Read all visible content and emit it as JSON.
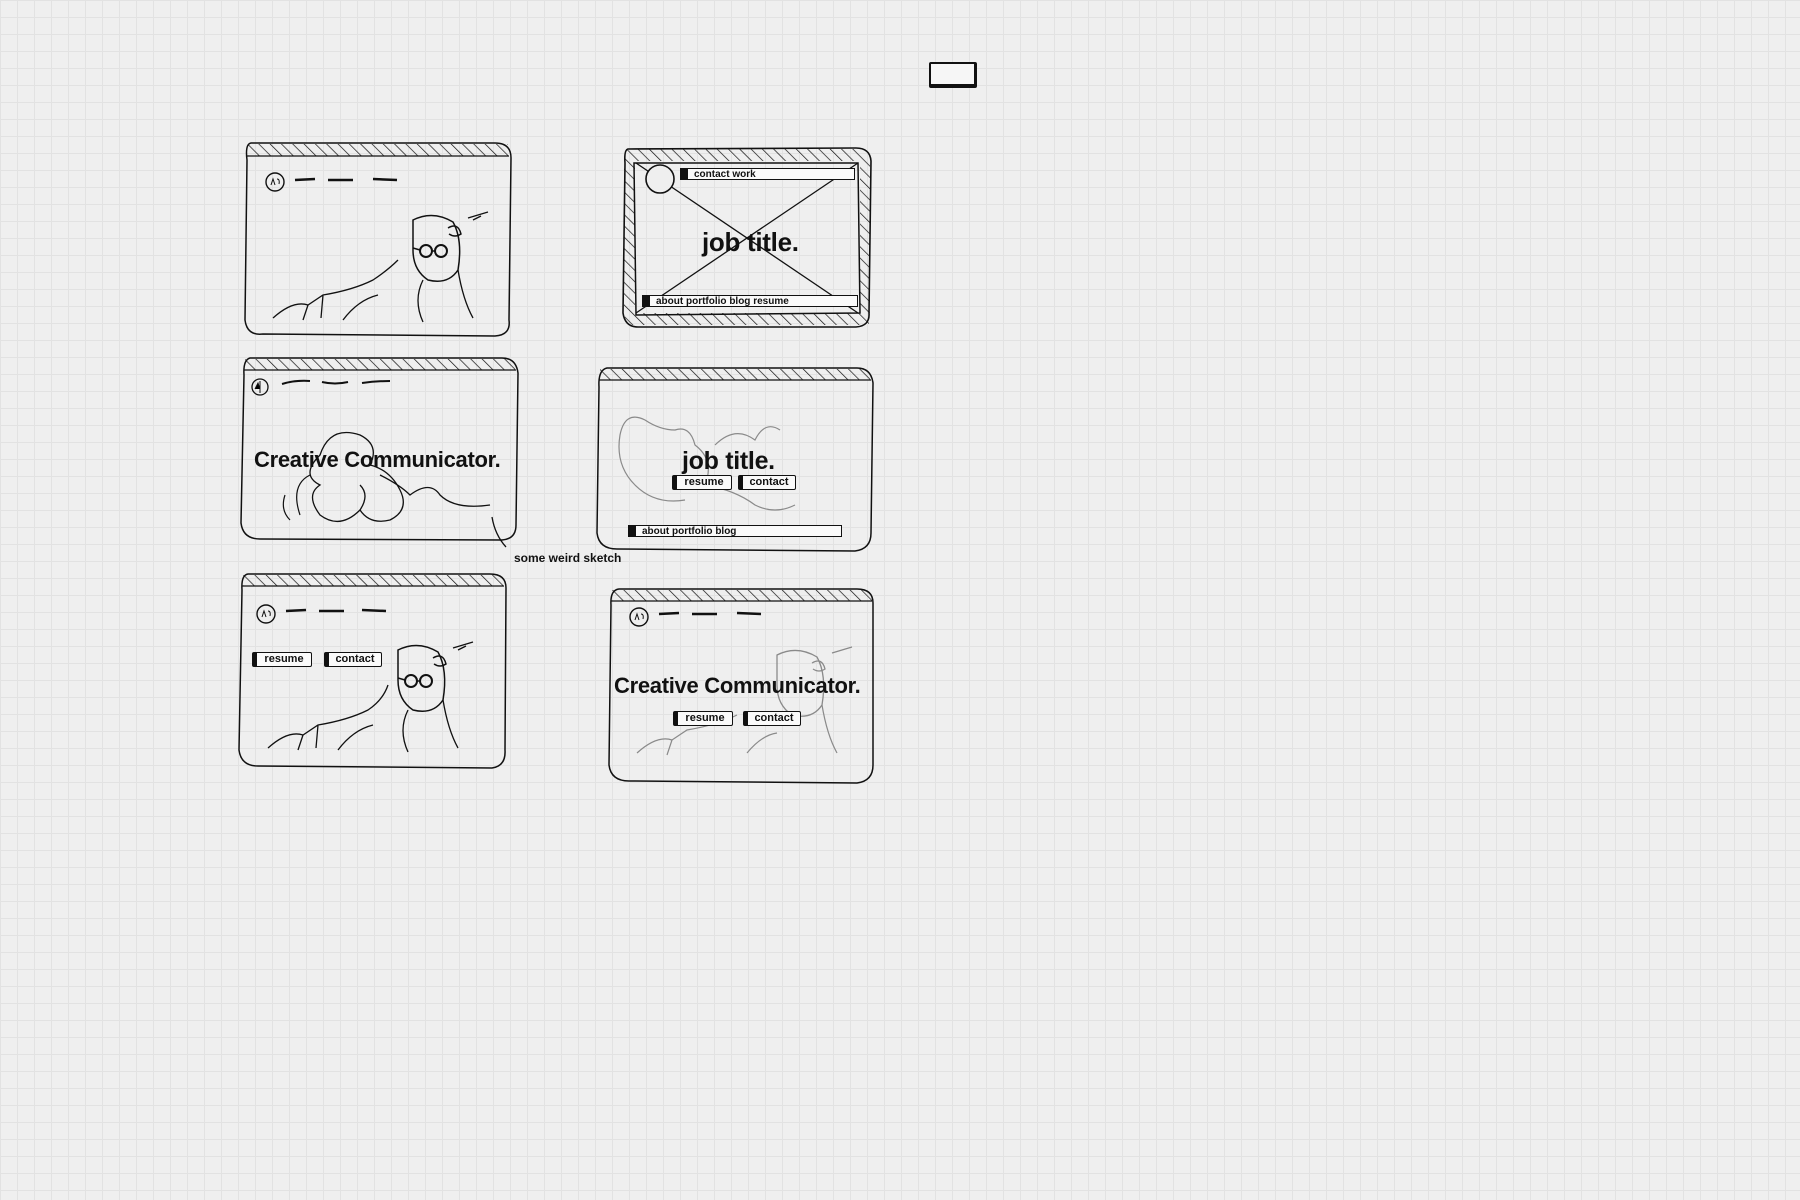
{
  "frames": [
    {
      "id": "f1"
    },
    {
      "id": "f2",
      "nav_top": "contact work",
      "headline": "job title.",
      "nav_bottom": "about portfolio blog resume"
    },
    {
      "id": "f3",
      "headline": "Creative Communicator."
    },
    {
      "id": "f4",
      "headline": "job title.",
      "buttons": [
        "resume",
        "contact"
      ],
      "nav_bottom": "about portfolio blog"
    },
    {
      "id": "f5",
      "buttons": [
        "resume",
        "contact"
      ]
    },
    {
      "id": "f6",
      "headline": "Creative Communicator.",
      "buttons": [
        "resume",
        "contact"
      ]
    }
  ],
  "annotation": "some weird sketch",
  "colors": {
    "background": "#efefef",
    "grid": "#e2e2e2",
    "ink": "#111111",
    "faded_ink": "#8a8a8a"
  }
}
